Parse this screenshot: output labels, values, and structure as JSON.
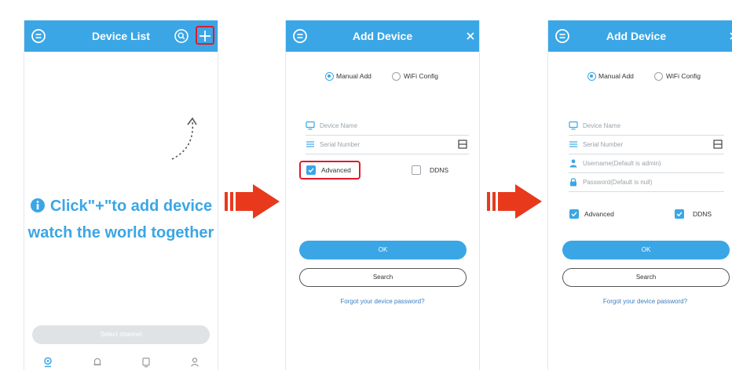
{
  "screen1": {
    "title": "Device List",
    "hint_line1": "Click\"+\"to add device",
    "hint_line2": "watch the world together",
    "select_channel": "Select channel"
  },
  "screen2": {
    "title": "Add Device",
    "radio_manual": "Manual Add",
    "radio_wifi": "WiFi Config",
    "device_name_placeholder": "Device Name",
    "serial_placeholder": "Serial Number",
    "advanced_label": "Advanced",
    "ddns_label": "DDNS",
    "ok_label": "OK",
    "search_label": "Search",
    "forgot_label": "Forgot your device password?"
  },
  "screen3": {
    "title": "Add Device",
    "radio_manual": "Manual Add",
    "radio_wifi": "WiFi Config",
    "device_name_placeholder": "Device Name",
    "serial_placeholder": "Serial Number",
    "username_placeholder": "Username(Default is admin)",
    "password_placeholder": "Password(Default is null)",
    "advanced_label": "Advanced",
    "ddns_label": "DDNS",
    "ok_label": "OK",
    "search_label": "Search",
    "forgot_label": "Forgot your device password?"
  },
  "colors": {
    "accent": "#3aa6e6",
    "highlight": "#e01b2b",
    "arrow": "#e8391d"
  },
  "icons": [
    "menu-icon",
    "search-icon",
    "plus-icon",
    "close-icon",
    "monitor-icon",
    "list-icon",
    "qr-scan-icon",
    "user-icon",
    "lock-icon",
    "info-icon",
    "camera-tab-icon",
    "bell-tab-icon",
    "device-tab-icon",
    "person-tab-icon",
    "arrow-right-icon"
  ]
}
